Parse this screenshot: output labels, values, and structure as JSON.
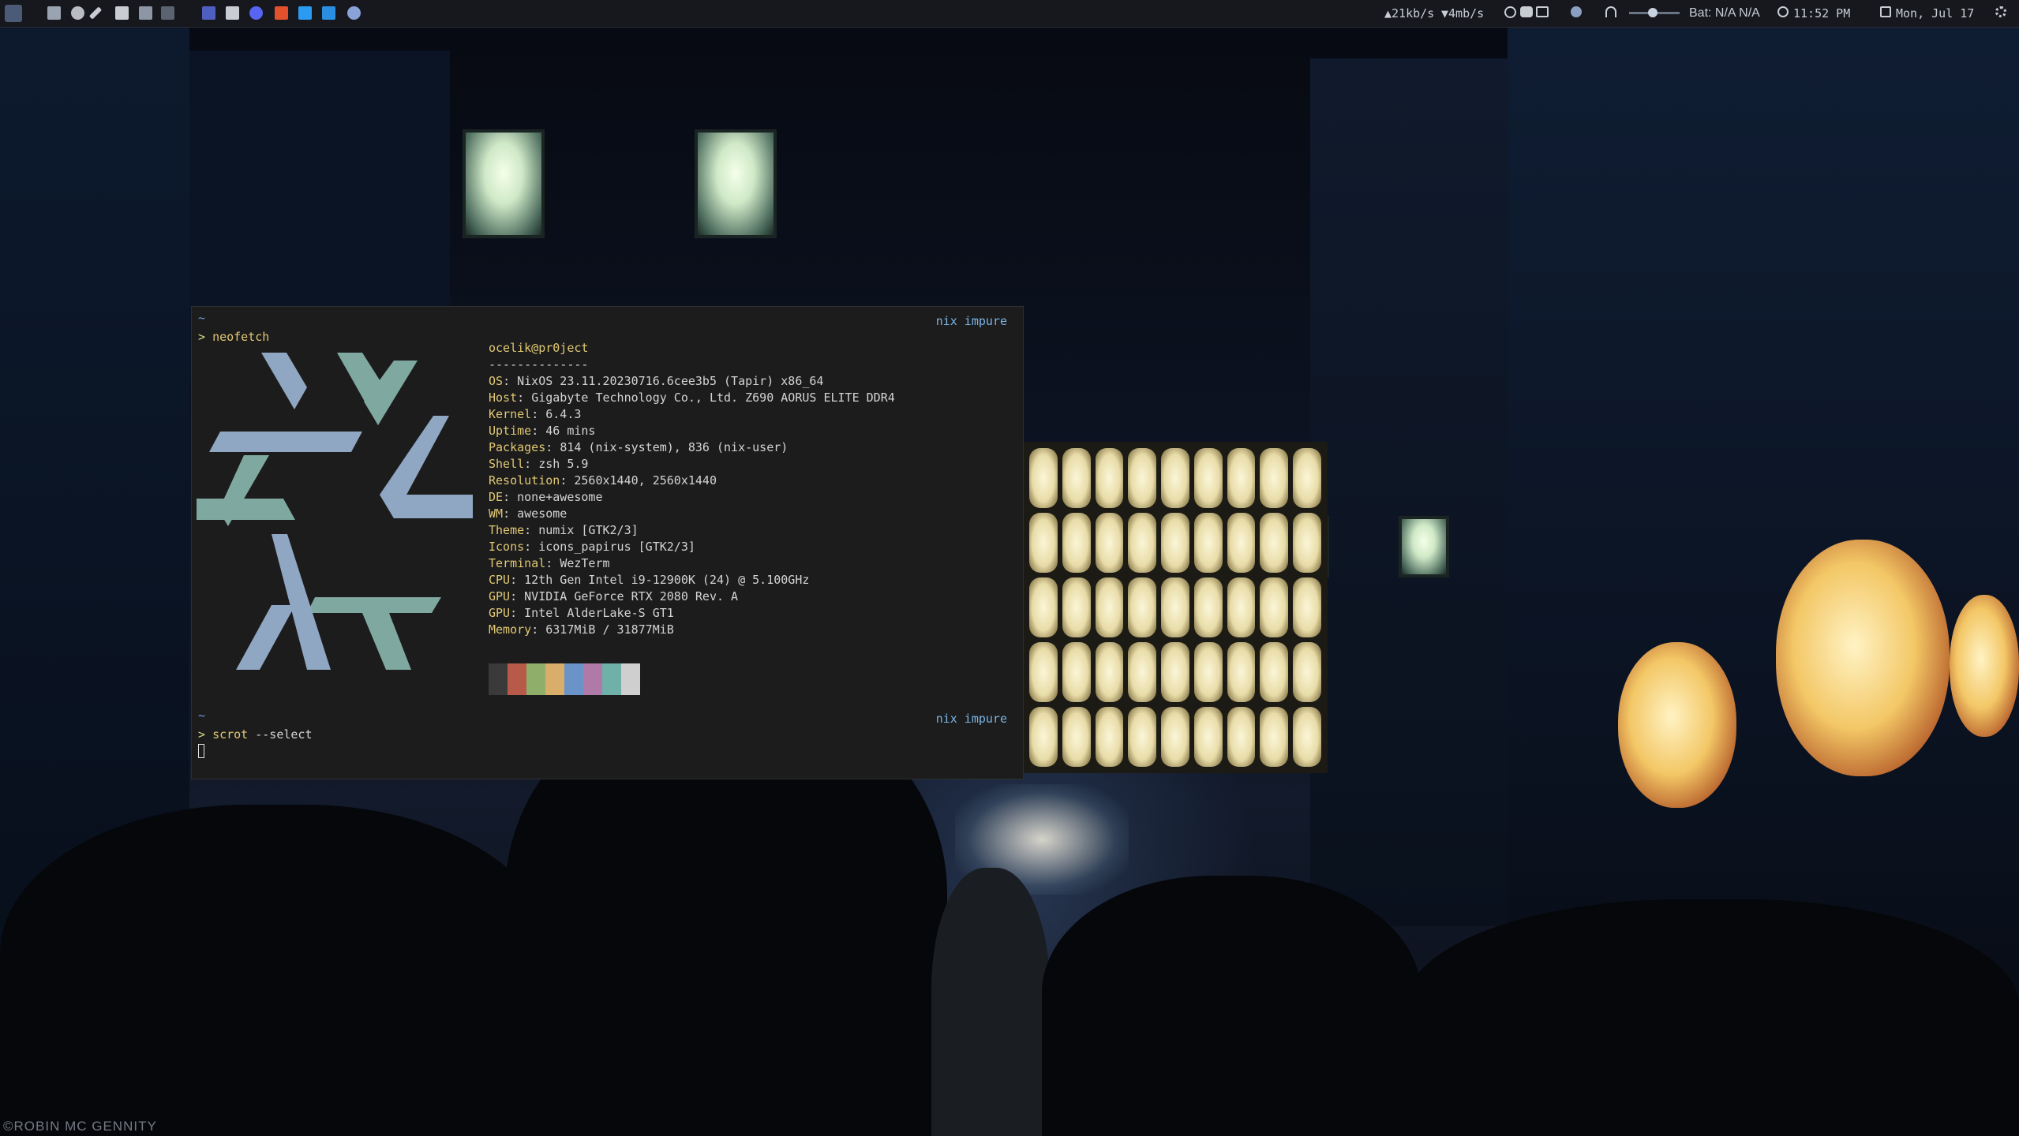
{
  "topbar": {
    "net_up": "▲21kb/s",
    "net_down": "▼4mb/s",
    "battery": "Bat: N/A N/A",
    "time": "11:52 PM",
    "date": "Mon, Jul 17",
    "launcher_icons": [
      "terminal-icon",
      "firefox-icon",
      "paintbrush-icon",
      "folder-icon",
      "notes-icon",
      "lock-icon",
      "teams-icon",
      "files-icon",
      "discord-icon",
      "brave-icon",
      "vscode-icon",
      "vscode-insiders-icon",
      "app-icon"
    ],
    "colors": {
      "bar_bg": "#16181d",
      "text": "#c8cdd4"
    }
  },
  "terminal": {
    "prompt_dir_1": "~",
    "prompt_1": "> ",
    "cmd_1": "neofetch",
    "status_right_1": "nix impure",
    "userhost": "ocelik@pr0ject",
    "separator": "--------------",
    "info": [
      {
        "label": "OS",
        "value": "NixOS 23.11.20230716.6cee3b5 (Tapir) x86_64"
      },
      {
        "label": "Host",
        "value": "Gigabyte Technology Co., Ltd. Z690 AORUS ELITE DDR4"
      },
      {
        "label": "Kernel",
        "value": "6.4.3"
      },
      {
        "label": "Uptime",
        "value": "46 mins"
      },
      {
        "label": "Packages",
        "value": "814 (nix-system), 836 (nix-user)"
      },
      {
        "label": "Shell",
        "value": "zsh 5.9"
      },
      {
        "label": "Resolution",
        "value": "2560x1440, 2560x1440"
      },
      {
        "label": "DE",
        "value": "none+awesome"
      },
      {
        "label": "WM",
        "value": "awesome"
      },
      {
        "label": "Theme",
        "value": "numix [GTK2/3]"
      },
      {
        "label": "Icons",
        "value": "icons_papirus [GTK2/3]"
      },
      {
        "label": "Terminal",
        "value": "WezTerm"
      },
      {
        "label": "CPU",
        "value": "12th Gen Intel i9-12900K (24) @ 5.100GHz"
      },
      {
        "label": "GPU",
        "value": "NVIDIA GeForce RTX 2080 Rev. A"
      },
      {
        "label": "GPU",
        "value": "Intel AlderLake-S GT1"
      },
      {
        "label": "Memory",
        "value": "6317MiB / 31877MiB"
      }
    ],
    "palette": [
      "#3a3a3a",
      "#b85a4a",
      "#8fae6a",
      "#d9ad6a",
      "#6a93c8",
      "#b07aa8",
      "#6fb0a8",
      "#cfcfcf"
    ],
    "prompt_dir_2": "~",
    "prompt_2": "> ",
    "cmd_2": "scrot",
    "cmd_2_args": " --select",
    "status_right_2": "nix impure"
  },
  "wallpaper": {
    "watermark": "©ROBIN MC GENNITY"
  }
}
